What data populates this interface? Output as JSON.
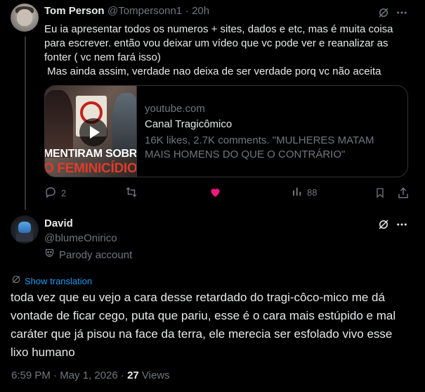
{
  "reply": {
    "author_name": "Tom Person",
    "handle": "@Tompersonn1",
    "separator": "·",
    "time": "20h",
    "text_lines": [
      "Eu ia apresentar todos os numeros + sites, dados e etc, mas é muita coisa",
      "para escrever. então vou deixar um vídeo que vc pode ver e reanalizar as",
      "fonter ( vc nem fará isso)",
      " Mas ainda assim, verdade nao deixa de ser verdade porq vc não aceita"
    ],
    "card": {
      "domain": "youtube.com",
      "title": "Canal Tragicômico",
      "desc_line1": "16K likes, 2.7K comments. \"MULHERES MATAM",
      "desc_line2": "MAIS HOMENS DO QUE O CONTRÁRIO\"",
      "thumb_caption1": "MENTIRAM SOBRE",
      "thumb_caption2": "O FEMINICÍDIO"
    },
    "actions": {
      "replies": "2",
      "retweets": "",
      "likes": "",
      "views": "88"
    }
  },
  "main": {
    "author_name": "David",
    "handle": "@blumeOnirico",
    "parody_label": "Parody account",
    "translate_label": "Show translation",
    "text_lines": [
      "toda vez que eu vejo a cara desse retardado do tragi-côco-mico me dá",
      "vontade de ficar cego, puta que pariu, esse é o cara mais estúpido e mal",
      "caráter que já pisou na face da terra, ele merecia ser esfolado vivo esse",
      "lixo humano"
    ],
    "timestamp": "6:59 PM · May 1, 2026 · ",
    "views_count": "27",
    "views_label": " Views"
  },
  "colors": {
    "background": "#000000",
    "text": "#e7e9ea",
    "muted": "#71767b",
    "accent": "#1d9bf0",
    "like": "#f91880",
    "border": "#2f3336"
  },
  "icons": [
    "grok-icon",
    "more-icon",
    "reply-icon",
    "retweet-icon",
    "heart-filled-icon",
    "views-icon",
    "bookmark-icon",
    "share-icon",
    "parody-mask-icon",
    "translate-icon",
    "play-icon"
  ]
}
